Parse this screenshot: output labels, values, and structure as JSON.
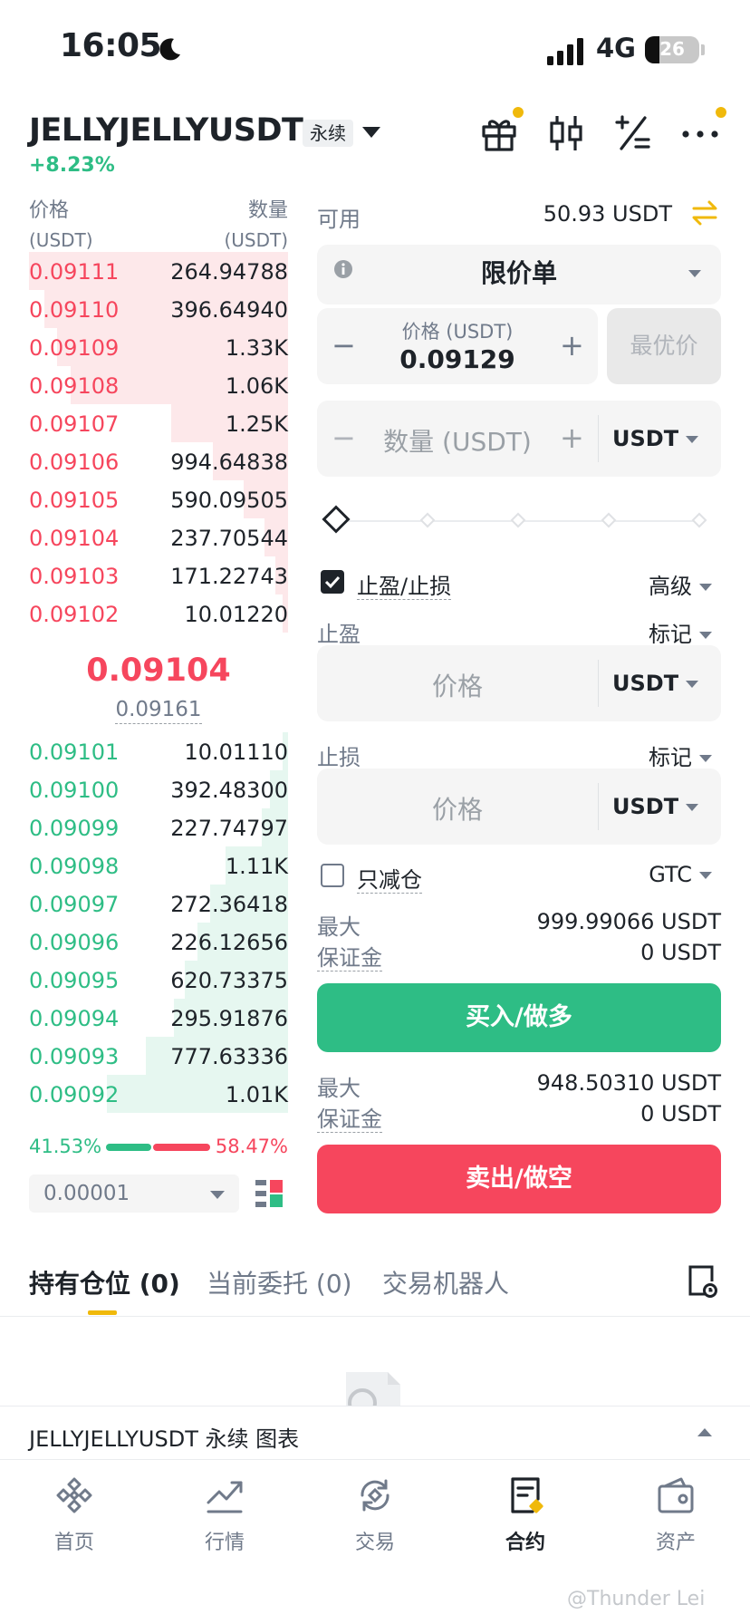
{
  "status_bar": {
    "time": "16:05",
    "network": "4G",
    "battery": "26"
  },
  "header": {
    "symbol": "JELLYJELLYUSDT",
    "contract_type": "永续",
    "change": "+8.23%",
    "icons": [
      "gift-icon",
      "candlestick-icon",
      "calculator-icon",
      "more-icon"
    ]
  },
  "order_book": {
    "price_header": "价格",
    "price_unit": "(USDT)",
    "qty_header": "数量",
    "qty_unit": "(USDT)",
    "asks": [
      {
        "price": "0.09111",
        "qty": "264.94788",
        "depth": 1.0
      },
      {
        "price": "0.09110",
        "qty": "396.64940",
        "depth": 0.94
      },
      {
        "price": "0.09109",
        "qty": "1.33K",
        "depth": 0.89
      },
      {
        "price": "0.09108",
        "qty": "1.06K",
        "depth": 0.84
      },
      {
        "price": "0.09107",
        "qty": "1.25K",
        "depth": 0.45
      },
      {
        "price": "0.09106",
        "qty": "994.64838",
        "depth": 0.29
      },
      {
        "price": "0.09105",
        "qty": "590.09505",
        "depth": 0.17
      },
      {
        "price": "0.09104",
        "qty": "237.70544",
        "depth": 0.09
      },
      {
        "price": "0.09103",
        "qty": "171.22743",
        "depth": 0.05
      },
      {
        "price": "0.09102",
        "qty": "10.01220",
        "depth": 0.02
      }
    ],
    "last_price": "0.09104",
    "mark_price": "0.09161",
    "bids": [
      {
        "price": "0.09101",
        "qty": "10.01110",
        "depth": 0.02
      },
      {
        "price": "0.09100",
        "qty": "392.48300",
        "depth": 0.07
      },
      {
        "price": "0.09099",
        "qty": "227.74797",
        "depth": 0.1
      },
      {
        "price": "0.09098",
        "qty": "1.11K",
        "depth": 0.24
      },
      {
        "price": "0.09097",
        "qty": "272.36418",
        "depth": 0.3
      },
      {
        "price": "0.09096",
        "qty": "226.12656",
        "depth": 0.35
      },
      {
        "price": "0.09095",
        "qty": "620.73375",
        "depth": 0.4
      },
      {
        "price": "0.09094",
        "qty": "295.91876",
        "depth": 0.44
      },
      {
        "price": "0.09093",
        "qty": "777.63336",
        "depth": 0.55
      },
      {
        "price": "0.09092",
        "qty": "1.01K",
        "depth": 0.7
      }
    ],
    "buy_ratio": "41.53%",
    "sell_ratio": "58.47%",
    "precision": "0.00001"
  },
  "form": {
    "available_label": "可用",
    "available_value": "50.93 USDT",
    "order_type": "限价单",
    "price_label": "价格 (USDT)",
    "price_value": "0.09129",
    "best_price_label": "最优价",
    "qty_placeholder": "数量 (USDT)",
    "qty_unit": "USDT",
    "tp_sl_label": "止盈/止损",
    "advanced_label": "高级",
    "take_profit_label": "止盈",
    "take_profit_trigger": "标记",
    "tp_price_placeholder": "价格",
    "tp_unit": "USDT",
    "stop_loss_label": "止损",
    "stop_loss_trigger": "标记",
    "sl_price_placeholder": "价格",
    "sl_unit": "USDT",
    "reduce_only_label": "只减仓",
    "time_in_force": "GTC",
    "buy_max_label": "最大",
    "buy_max_value": "999.99066 USDT",
    "buy_margin_label": "保证金",
    "buy_margin_value": "0 USDT",
    "buy_button": "买入/做多",
    "sell_max_label": "最大",
    "sell_max_value": "948.50310 USDT",
    "sell_margin_label": "保证金",
    "sell_margin_value": "0 USDT",
    "sell_button": "卖出/做空",
    "tp_sl_checked": true,
    "reduce_only_checked": false
  },
  "tabs": [
    {
      "label": "持有仓位 (0)",
      "active": true
    },
    {
      "label": "当前委托 (0)",
      "active": false
    },
    {
      "label": "交易机器人",
      "active": false
    }
  ],
  "chart_bar": {
    "label": "JELLYJELLYUSDT 永续  图表"
  },
  "bottom_nav": [
    {
      "label": "首页",
      "icon": "home-icon"
    },
    {
      "label": "行情",
      "icon": "markets-icon"
    },
    {
      "label": "交易",
      "icon": "trade-icon"
    },
    {
      "label": "合约",
      "icon": "futures-icon",
      "active": true
    },
    {
      "label": "资产",
      "icon": "wallet-icon"
    }
  ],
  "watermark": "@Thunder Lei",
  "colors": {
    "green": "#2ebd85",
    "red": "#f6465d",
    "accent": "#f0b90b"
  }
}
